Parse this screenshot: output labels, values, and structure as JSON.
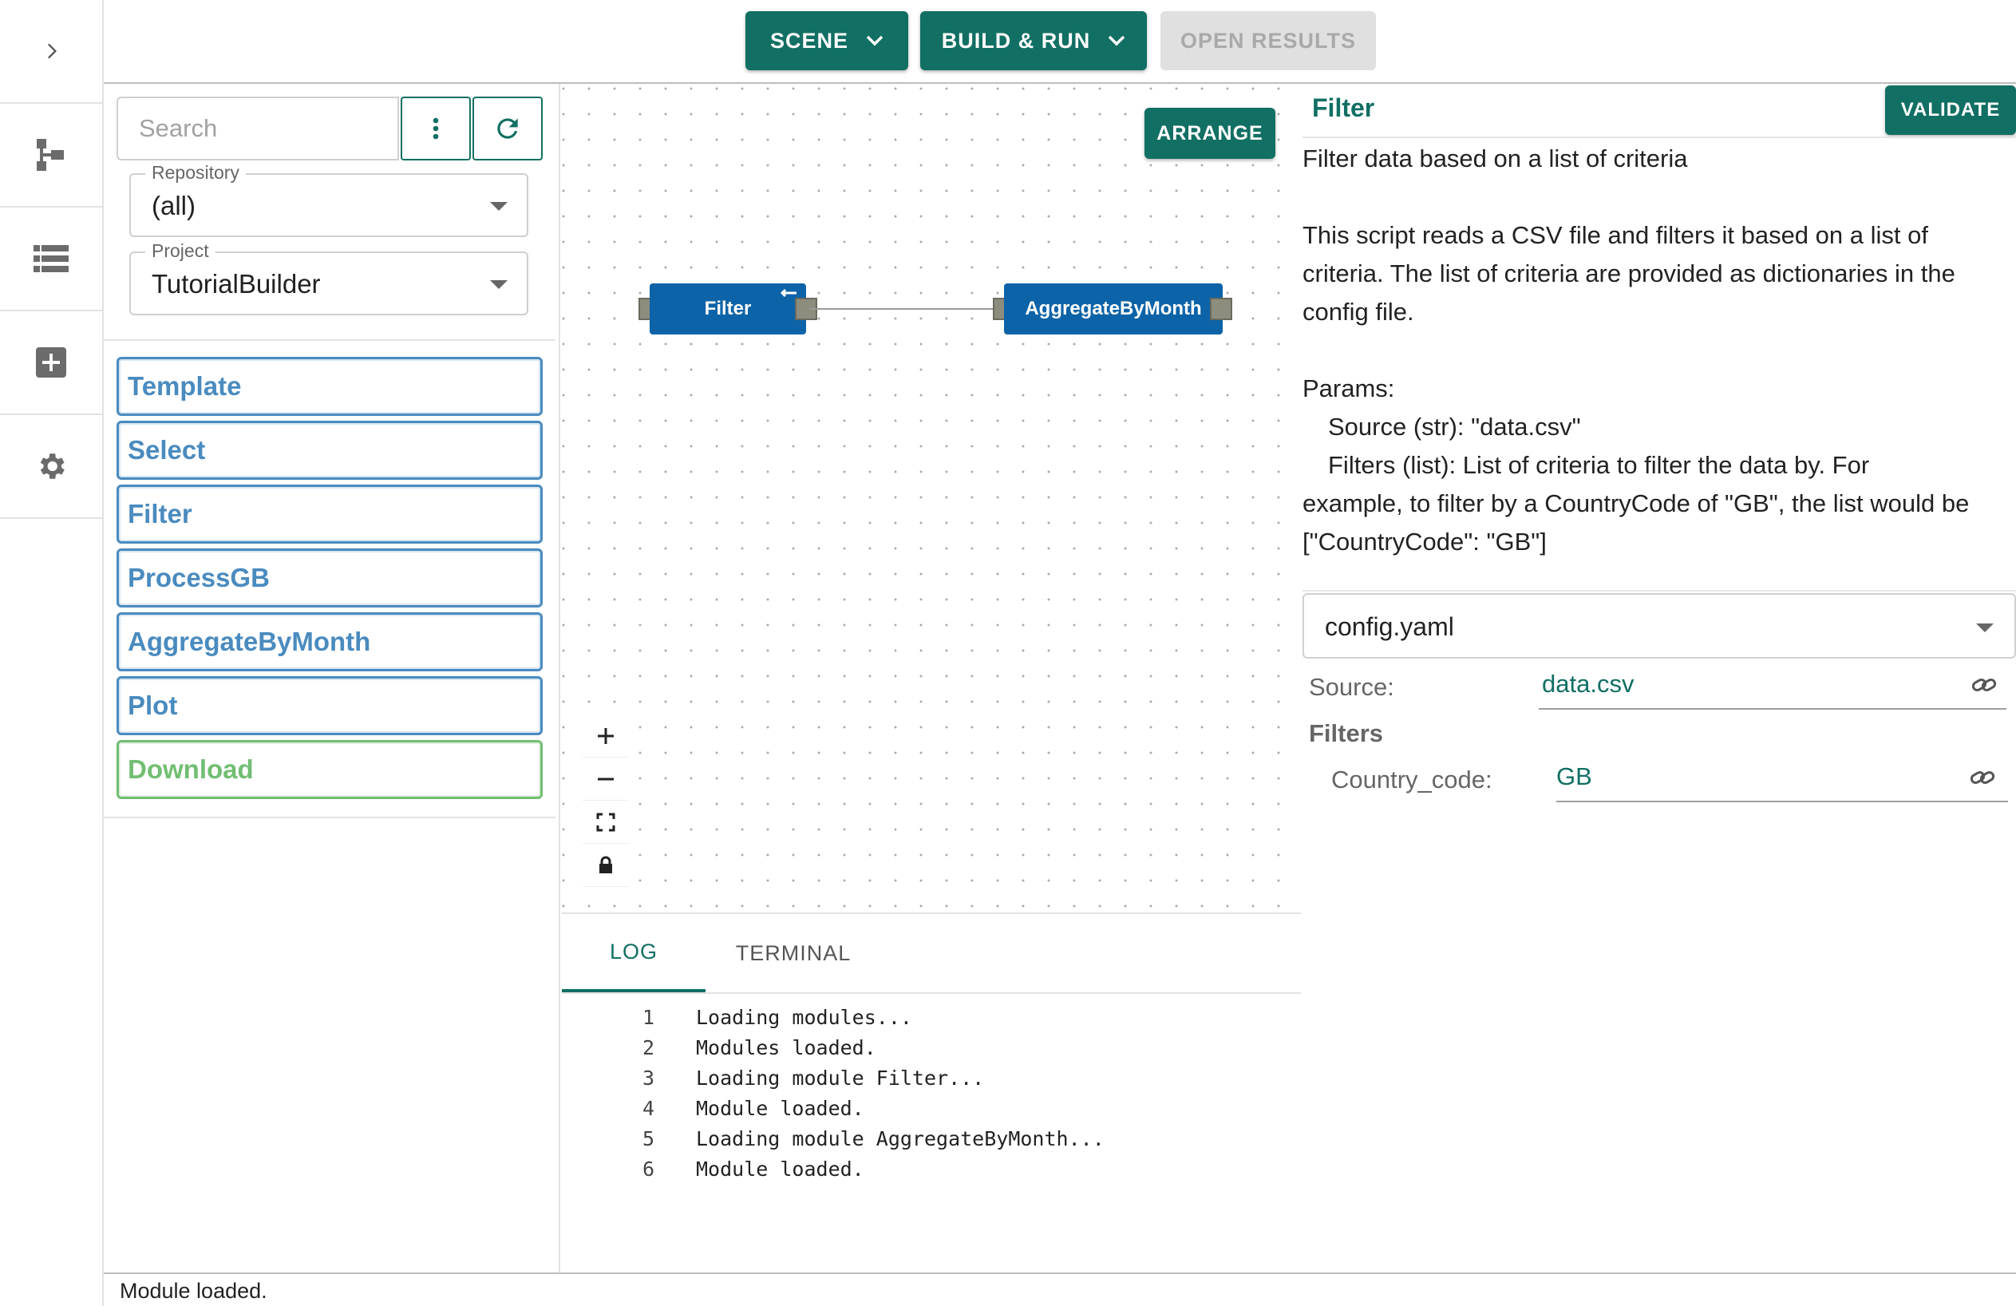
{
  "rail": {
    "items": [
      {
        "icon": "chevron-right-icon"
      },
      {
        "icon": "tree-structure-icon"
      },
      {
        "icon": "list-icon"
      },
      {
        "icon": "add-box-icon"
      },
      {
        "icon": "gear-icon"
      }
    ]
  },
  "toolbar": {
    "scene_label": "SCENE",
    "build_run_label": "BUILD & RUN",
    "open_results_label": "OPEN RESULTS"
  },
  "modules_panel": {
    "search_placeholder": "Search",
    "repository": {
      "label": "Repository",
      "value": "(all)"
    },
    "project": {
      "label": "Project",
      "value": "TutorialBuilder"
    },
    "items": [
      {
        "label": "Template"
      },
      {
        "label": "Select"
      },
      {
        "label": "Filter"
      },
      {
        "label": "ProcessGB"
      },
      {
        "label": "AggregateByMonth"
      },
      {
        "label": "Plot"
      },
      {
        "label": "Download"
      }
    ]
  },
  "canvas": {
    "arrange_label": "ARRANGE",
    "nodes": [
      {
        "label": "Filter"
      },
      {
        "label": "AggregateByMonth"
      }
    ]
  },
  "log_panel": {
    "tabs": [
      {
        "label": "LOG",
        "active": true
      },
      {
        "label": "TERMINAL",
        "active": false
      }
    ],
    "lines": [
      {
        "n": "1",
        "text": "Loading modules..."
      },
      {
        "n": "2",
        "text": "Modules loaded."
      },
      {
        "n": "3",
        "text": "Loading module Filter..."
      },
      {
        "n": "4",
        "text": "Module loaded."
      },
      {
        "n": "5",
        "text": "Loading module AggregateByMonth..."
      },
      {
        "n": "6",
        "text": "Module loaded."
      }
    ]
  },
  "properties": {
    "title": "Filter",
    "validate_label": "VALIDATE",
    "doc": {
      "summary": "Filter data based on a list of criteria",
      "description": "This script reads a CSV file and filters it based on a list of criteria. The list of criteria are provided as dictionaries in the config file.",
      "params_heading": "Params:",
      "param_source": "Source (str): \"data.csv\"",
      "param_filters": "Filters (list): List of criteria to filter the data by. For",
      "param_filters_cont": "example, to filter by a CountryCode of \"GB\", the list would be [\"CountryCode\": \"GB\"]"
    },
    "config_file": "config.yaml",
    "source": {
      "label": "Source:",
      "value": "data.csv"
    },
    "filters_heading": "Filters",
    "country_code": {
      "label": "Country_code:",
      "value": "GB"
    }
  },
  "status": {
    "text": "Module loaded."
  },
  "colors": {
    "accent": "#116f63",
    "node_blue": "#0d63a7",
    "module_blue": "#4a8bbf",
    "module_green": "#71be72"
  }
}
